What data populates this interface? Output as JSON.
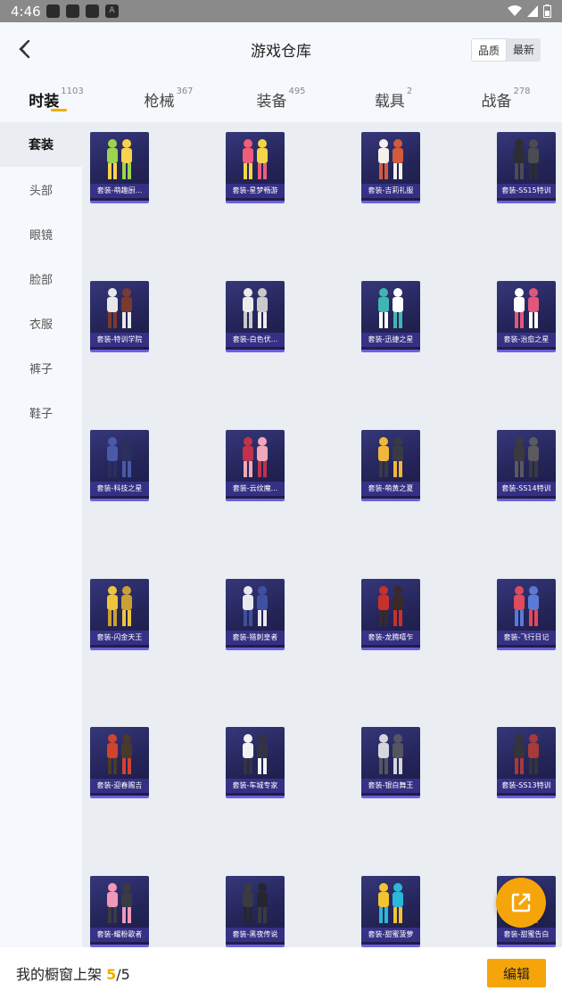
{
  "status_bar": {
    "time": "4:46",
    "notif_letter": "A"
  },
  "header": {
    "title": "游戏仓库",
    "sort": {
      "options": [
        "品质",
        "最新"
      ],
      "active": "品质"
    }
  },
  "tabs": [
    {
      "label": "时装",
      "count": "1103",
      "active": true
    },
    {
      "label": "枪械",
      "count": "367"
    },
    {
      "label": "装备",
      "count": "495"
    },
    {
      "label": "载具",
      "count": "2"
    },
    {
      "label": "战备",
      "count": "278"
    }
  ],
  "sidebar": [
    {
      "label": "套装",
      "active": true
    },
    {
      "label": "头部"
    },
    {
      "label": "眼镜"
    },
    {
      "label": "脸部"
    },
    {
      "label": "衣服"
    },
    {
      "label": "裤子"
    },
    {
      "label": "鞋子"
    }
  ],
  "items": [
    {
      "name": "套装-萌趣厨...",
      "colors": [
        "#9bd44e",
        "#f6d34a"
      ]
    },
    {
      "name": "套装-星梦畅游",
      "colors": [
        "#ef5d7a",
        "#f3d548"
      ]
    },
    {
      "name": "套装-吉莉礼服",
      "colors": [
        "#f4f1ea",
        "#d15b3c"
      ]
    },
    {
      "name": "套装-SS15特训",
      "colors": [
        "#2d2d33",
        "#4b4b52"
      ]
    },
    {
      "name": "套装-特训学院",
      "colors": [
        "#e8e8ea",
        "#7a3a2e"
      ]
    },
    {
      "name": "套装-白色伏...",
      "colors": [
        "#ececec",
        "#c9c9c9"
      ]
    },
    {
      "name": "套装-迅捷之星",
      "colors": [
        "#3fb7b0",
        "#ffffff"
      ]
    },
    {
      "name": "套装-治愈之星",
      "colors": [
        "#ffffff",
        "#e0577a"
      ]
    },
    {
      "name": "套装-科技之星",
      "colors": [
        "#4a5aa8",
        "#2a2f5e"
      ]
    },
    {
      "name": "套装-云纹魔...",
      "colors": [
        "#c2324a",
        "#f0a8b8"
      ]
    },
    {
      "name": "套装-萌黄之夏",
      "colors": [
        "#f0b73a",
        "#3a3a44"
      ]
    },
    {
      "name": "套装-SS14特训",
      "colors": [
        "#3a3a40",
        "#5a5a60"
      ]
    },
    {
      "name": "套装-闪金天王",
      "colors": [
        "#f0c43a",
        "#caa031"
      ]
    },
    {
      "name": "套装-猎刺皇者",
      "colors": [
        "#e8e8ee",
        "#4050a0"
      ]
    },
    {
      "name": "套装-龙腾嘻乍",
      "colors": [
        "#c8312a",
        "#3a2a2a"
      ]
    },
    {
      "name": "套装-飞行日记",
      "colors": [
        "#e04a5a",
        "#5a7ad8"
      ]
    },
    {
      "name": "套装-迎春赐吉",
      "colors": [
        "#d2432c",
        "#4a3a2a"
      ]
    },
    {
      "name": "套装-车城专家",
      "colors": [
        "#f2f2f2",
        "#333344"
      ]
    },
    {
      "name": "套装-银白舞王",
      "colors": [
        "#d6d6dc",
        "#555560"
      ]
    },
    {
      "name": "套装-SS13特训",
      "colors": [
        "#34343a",
        "#a83a3a"
      ]
    },
    {
      "name": "套装-耀粉歌者",
      "colors": [
        "#f098b8",
        "#3a3a44"
      ]
    },
    {
      "name": "套装-黑夜传说",
      "colors": [
        "#3a3a40",
        "#262630"
      ]
    },
    {
      "name": "套装-甜蜜菠萝",
      "colors": [
        "#f2c432",
        "#2bb8d8"
      ]
    },
    {
      "name": "套装-甜蜜告白",
      "colors": [
        "#e05a7a",
        "#f4f4f4"
      ]
    }
  ],
  "bottom": {
    "showcase_label": "我的橱窗上架",
    "showcase_current": "5",
    "showcase_sep": "/",
    "showcase_total": "5",
    "edit_label": "编辑"
  },
  "theme": {
    "accent": "#f5a50a",
    "card_bg": "#2a2a60",
    "card_border": "#6f5fe0"
  }
}
